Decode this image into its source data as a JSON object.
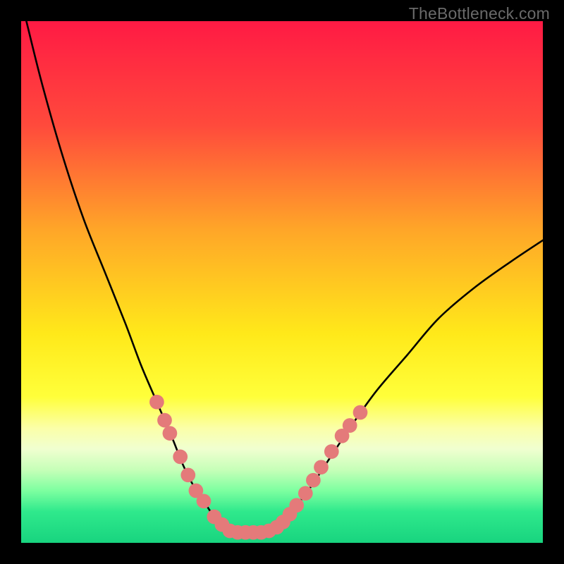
{
  "watermark": "TheBottleneck.com",
  "chart_data": {
    "type": "line",
    "title": "",
    "xlabel": "",
    "ylabel": "",
    "xlim": [
      0,
      100
    ],
    "ylim": [
      0,
      100
    ],
    "grid": false,
    "legend": false,
    "gradient_stops": [
      {
        "offset": 0,
        "color": "#ff1a44"
      },
      {
        "offset": 20,
        "color": "#ff4a3c"
      },
      {
        "offset": 40,
        "color": "#ffa628"
      },
      {
        "offset": 60,
        "color": "#ffe91a"
      },
      {
        "offset": 72,
        "color": "#ffff3a"
      },
      {
        "offset": 78,
        "color": "#fbffa8"
      },
      {
        "offset": 82,
        "color": "#f0ffd0"
      },
      {
        "offset": 86,
        "color": "#c6ffb8"
      },
      {
        "offset": 90,
        "color": "#7dffa0"
      },
      {
        "offset": 94,
        "color": "#2fe98c"
      },
      {
        "offset": 100,
        "color": "#18d47f"
      }
    ],
    "series": [
      {
        "name": "bottleneck-curve",
        "color": "#000000",
        "x": [
          1,
          4,
          8,
          12,
          16,
          20,
          23,
          26,
          29,
          31,
          33,
          35,
          37,
          39,
          41,
          43,
          47,
          49,
          51,
          55,
          59,
          63,
          68,
          74,
          80,
          87,
          94,
          100
        ],
        "y": [
          100,
          88,
          74,
          62,
          52,
          42,
          34,
          27,
          20,
          15,
          11,
          8,
          5,
          3,
          2,
          2,
          2,
          3,
          5,
          10,
          16,
          22,
          29,
          36,
          43,
          49,
          54,
          58
        ]
      }
    ],
    "markers": {
      "color": "#e47a7a",
      "radius": 1.4,
      "points": [
        {
          "x": 26,
          "y": 27
        },
        {
          "x": 27.5,
          "y": 23.5
        },
        {
          "x": 28.5,
          "y": 21
        },
        {
          "x": 30.5,
          "y": 16.5
        },
        {
          "x": 32,
          "y": 13
        },
        {
          "x": 33.5,
          "y": 10
        },
        {
          "x": 35,
          "y": 8
        },
        {
          "x": 37,
          "y": 5
        },
        {
          "x": 38.5,
          "y": 3.5
        },
        {
          "x": 40,
          "y": 2.3
        },
        {
          "x": 41.5,
          "y": 2
        },
        {
          "x": 43,
          "y": 2
        },
        {
          "x": 44.5,
          "y": 2
        },
        {
          "x": 46,
          "y": 2
        },
        {
          "x": 47.5,
          "y": 2.3
        },
        {
          "x": 49,
          "y": 3
        },
        {
          "x": 50.2,
          "y": 4
        },
        {
          "x": 51.5,
          "y": 5.5
        },
        {
          "x": 52.8,
          "y": 7.2
        },
        {
          "x": 54.5,
          "y": 9.5
        },
        {
          "x": 56,
          "y": 12
        },
        {
          "x": 57.5,
          "y": 14.5
        },
        {
          "x": 59.5,
          "y": 17.5
        },
        {
          "x": 61.5,
          "y": 20.5
        },
        {
          "x": 63,
          "y": 22.5
        },
        {
          "x": 65,
          "y": 25
        }
      ]
    }
  }
}
